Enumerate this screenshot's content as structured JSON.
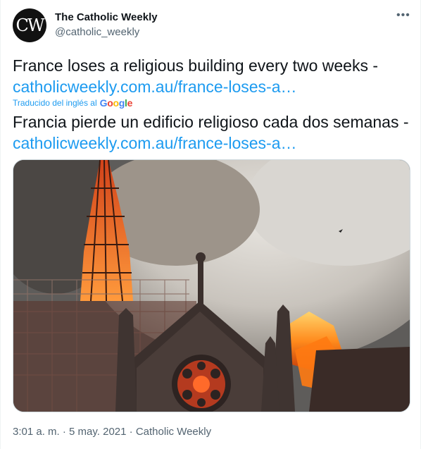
{
  "author": {
    "avatar_text": "CW",
    "name": "The Catholic Weekly",
    "handle": "@catholic_weekly"
  },
  "tweet": {
    "text_en": "France loses a religious building every two weeks - ",
    "link_en": "catholicweekly.com.au/france-loses-a…",
    "translated_by": "Traducido del inglés al",
    "translation_provider": "Google",
    "text_es": "Francia pierde un edificio religioso cada dos semanas -",
    "link_es": "catholicweekly.com.au/france-loses-a…"
  },
  "media": {
    "icon": "photo-cathedral-fire"
  },
  "meta": {
    "time": "3:01 a. m.",
    "separator": "·",
    "date": "5 may. 2021",
    "source": "Catholic Weekly"
  },
  "colors": {
    "link": "#1d9bf0",
    "secondary_text": "#536471",
    "primary_text": "#0f1419"
  },
  "more_icon": "more-horizontal-icon"
}
